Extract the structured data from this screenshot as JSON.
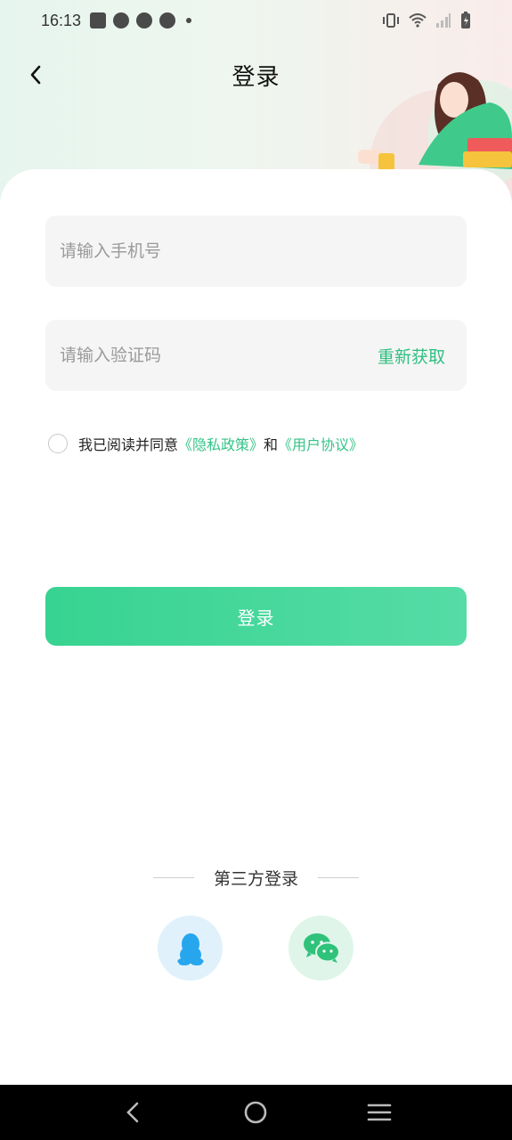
{
  "status_bar": {
    "time": "16:13"
  },
  "nav": {
    "title": "登录"
  },
  "form": {
    "phone_placeholder": "请输入手机号",
    "code_placeholder": "请输入验证码",
    "resend_label": "重新获取"
  },
  "agreement": {
    "prefix": "我已阅读并同意",
    "privacy": "《隐私政策》",
    "and": "和",
    "terms": "《用户协议》"
  },
  "login_button": "登录",
  "third_party": {
    "title": "第三方登录",
    "providers": [
      "qq-icon",
      "wechat-icon"
    ]
  },
  "colors": {
    "accent": "#35c389",
    "button_start": "#37d391",
    "button_end": "#56dca6"
  }
}
